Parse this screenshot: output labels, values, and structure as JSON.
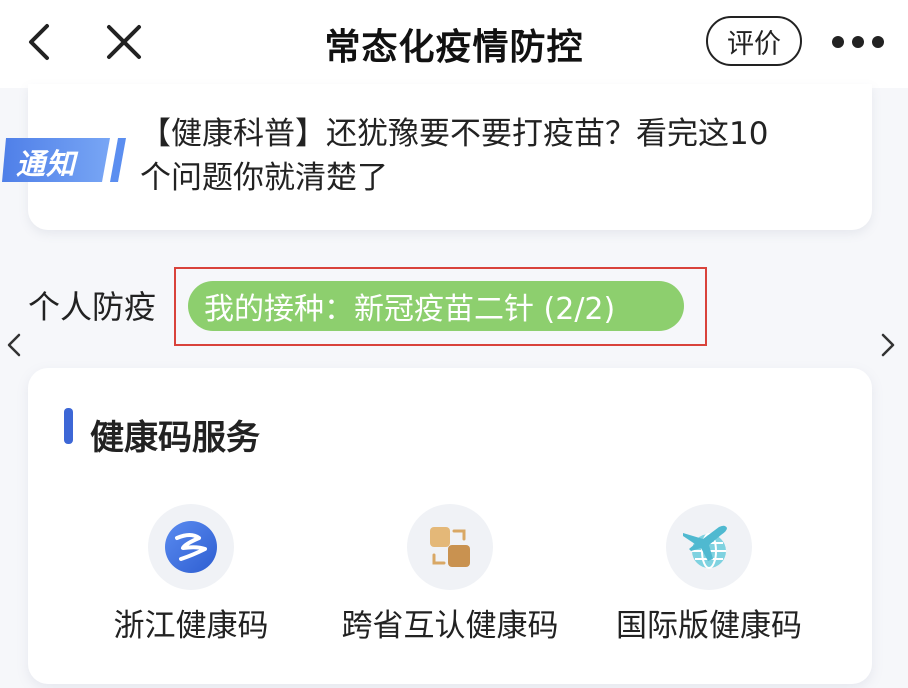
{
  "header": {
    "title": "常态化疫情防控",
    "rate_label": "评价",
    "back_icon": "chevron-left-icon",
    "close_icon": "close-icon",
    "more_icon": "more-dots-icon"
  },
  "notice": {
    "badge": "通知",
    "badge_color": "#5b8ef0",
    "line1": "【健康科普】还犹豫要不要打疫苗？看完这10",
    "line2": "个问题你就清楚了"
  },
  "personal": {
    "label": "个人防疫",
    "vaccine_status": "我的接种：新冠疫苗二针 (2/2)",
    "pill_color": "#8dcf6e",
    "highlight_color": "#d9433b"
  },
  "services": {
    "title": "健康码服务",
    "accent": "#3d67d6",
    "items": [
      {
        "label": "浙江健康码",
        "icon": "zhejiang-code-icon"
      },
      {
        "label": "跨省互认健康码",
        "icon": "cross-province-code-icon"
      },
      {
        "label": "国际版健康码",
        "icon": "international-code-icon"
      }
    ]
  }
}
